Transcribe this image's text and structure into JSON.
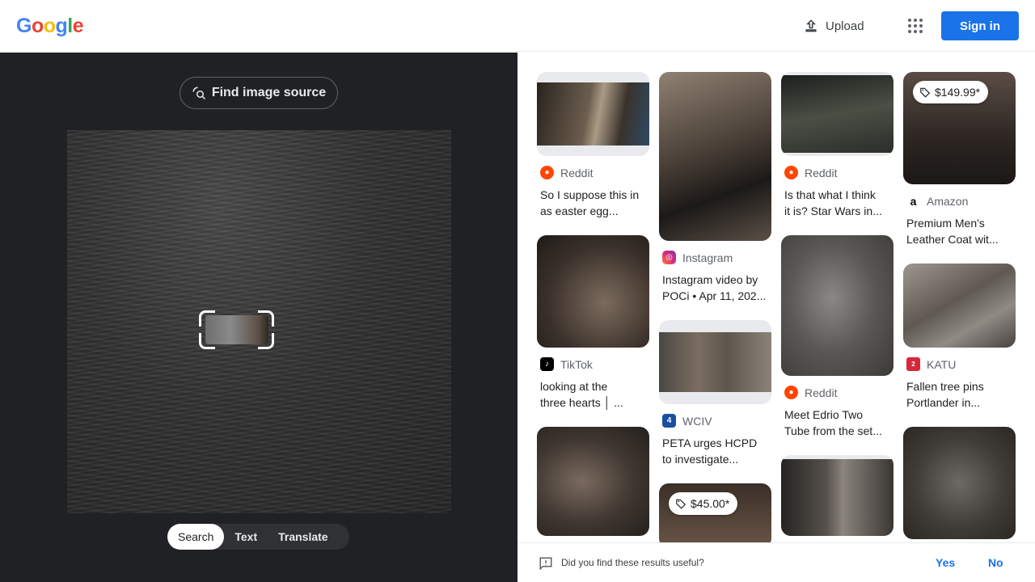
{
  "header": {
    "logo_letters": [
      "G",
      "o",
      "o",
      "g",
      "l",
      "e"
    ],
    "logo_colors": [
      "#4285f4",
      "#ea4335",
      "#fbbc05",
      "#4285f4",
      "#34a853",
      "#ea4335"
    ],
    "upload_label": "Upload",
    "signin_label": "Sign in"
  },
  "lens": {
    "find_source_label": "Find image source",
    "modes": [
      "Search",
      "Text",
      "Translate"
    ],
    "active_mode": "Search"
  },
  "results": [
    {
      "source": "Reddit",
      "favicon": "reddit-icon",
      "title_lines": [
        "So I suppose this in",
        "as easter egg..."
      ]
    },
    {
      "source": "Instagram",
      "favicon": "instagram-icon",
      "title_lines": [
        "Instagram video by",
        "POCi • Apr 11, 202..."
      ]
    },
    {
      "source": "Reddit",
      "favicon": "reddit-icon",
      "title_lines": [
        "Is that what I think",
        "it is? Star Wars in..."
      ]
    },
    {
      "source": "Amazon",
      "favicon": "amazon-icon",
      "price": "$149.99*",
      "title_lines": [
        "Premium Men's",
        "Leather Coat wit..."
      ]
    },
    {
      "source": "TikTok",
      "favicon": "tiktok-icon",
      "title_lines": [
        "looking at the",
        "three hearts │ ..."
      ]
    },
    {
      "source": "WCIV",
      "favicon": "wciv-icon",
      "title_lines": [
        "PETA urges HCPD",
        "to investigate..."
      ]
    },
    {
      "source": "Reddit",
      "favicon": "reddit-icon",
      "title_lines": [
        "Meet Edrio Two",
        "Tube from the set..."
      ]
    },
    {
      "source": "KATU",
      "favicon": "katu-icon",
      "title_lines": [
        "Fallen tree pins",
        "Portlander in..."
      ]
    },
    {
      "price": "$45.00*"
    }
  ],
  "feedback": {
    "question": "Did you find these results useful?",
    "yes": "Yes",
    "no": "No"
  }
}
